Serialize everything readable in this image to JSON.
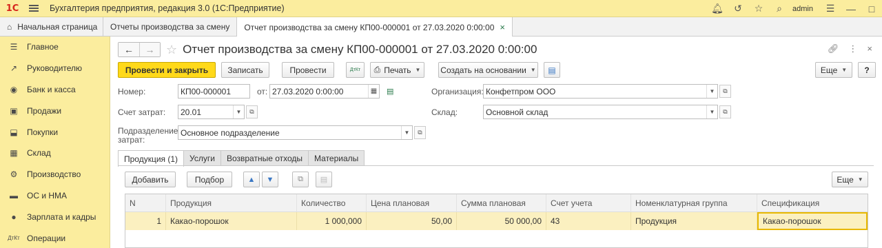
{
  "titlebar": {
    "logo": "1С",
    "title": "Бухгалтерия предприятия, редакция 3.0  (1С:Предприятие)",
    "user": "admin"
  },
  "window_tabs": [
    {
      "label": "Начальная страница"
    },
    {
      "label": "Отчеты производства за смену"
    },
    {
      "label": "Отчет производства за смену КП00-000001 от 27.03.2020 0:00:00",
      "close": "×"
    }
  ],
  "sidebar": {
    "items": [
      {
        "label": "Главное",
        "icon": "menu-icon"
      },
      {
        "label": "Руководителю",
        "icon": "chart-icon"
      },
      {
        "label": "Банк и касса",
        "icon": "coin-icon"
      },
      {
        "label": "Продажи",
        "icon": "bag-icon"
      },
      {
        "label": "Покупки",
        "icon": "cart-icon"
      },
      {
        "label": "Склад",
        "icon": "warehouse-icon"
      },
      {
        "label": "Производство",
        "icon": "factory-icon"
      },
      {
        "label": "ОС и НМА",
        "icon": "truck-icon"
      },
      {
        "label": "Зарплата и кадры",
        "icon": "person-icon"
      },
      {
        "label": "Операции",
        "icon": "dt-kt-icon"
      }
    ]
  },
  "document": {
    "title": "Отчет производства за смену КП00-000001 от 27.03.2020 0:00:00"
  },
  "toolbar": {
    "post_close": "Провести и закрыть",
    "save": "Записать",
    "post": "Провести",
    "dtkt": "ДтКт",
    "print": "Печать",
    "create_based": "Создать на основании",
    "more": "Еще",
    "help": "?"
  },
  "form": {
    "number_label": "Номер:",
    "number_value": "КП00-000001",
    "from_label": "от:",
    "date_value": "27.03.2020  0:00:00",
    "org_label": "Организация:",
    "org_value": "Конфетпром ООО",
    "cost_account_label": "Счет затрат:",
    "cost_account_value": "20.01",
    "warehouse_label": "Склад:",
    "warehouse_value": "Основной склад",
    "dept_label_1": "Подразделение",
    "dept_label_2": "затрат:",
    "dept_value": "Основное подразделение"
  },
  "panel_tabs": [
    {
      "label": "Продукция (1)"
    },
    {
      "label": "Услуги"
    },
    {
      "label": "Возвратные отходы"
    },
    {
      "label": "Материалы"
    }
  ],
  "table_toolbar": {
    "add": "Добавить",
    "pick": "Подбор",
    "more": "Еще"
  },
  "table": {
    "columns": [
      "N",
      "Продукция",
      "Количество",
      "Цена плановая",
      "Сумма плановая",
      "Счет учета",
      "Номенклатурная группа",
      "Спецификация"
    ],
    "rows": [
      [
        "1",
        "Какао-порошок",
        "1 000,000",
        "50,00",
        "50 000,00",
        "43",
        "Продукция",
        "Какао-порошок"
      ]
    ]
  }
}
